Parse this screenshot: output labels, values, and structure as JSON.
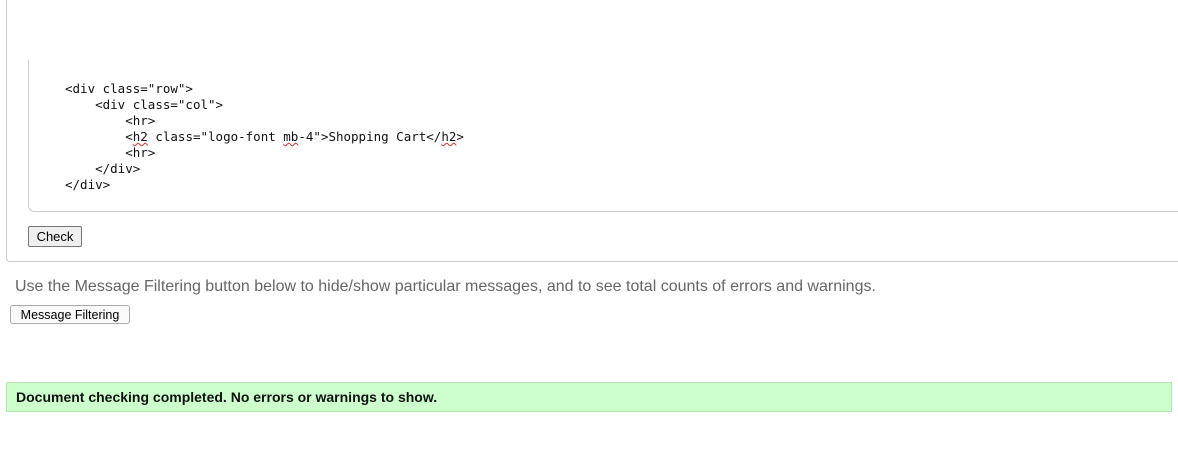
{
  "source": {
    "lines": [
      {
        "indent": 0,
        "segments": [
          {
            "text": "<div class=\"row\">",
            "spell": false
          }
        ]
      },
      {
        "indent": 1,
        "segments": [
          {
            "text": "<div class=\"col\">",
            "spell": false
          }
        ]
      },
      {
        "indent": 2,
        "segments": [
          {
            "text": "<hr>",
            "spell": false
          }
        ]
      },
      {
        "indent": 2,
        "segments": [
          {
            "text": "<",
            "spell": false
          },
          {
            "text": "h2",
            "spell": true
          },
          {
            "text": " class=\"logo-font ",
            "spell": false
          },
          {
            "text": "mb",
            "spell": true
          },
          {
            "text": "-4\">Shopping Cart</",
            "spell": false
          },
          {
            "text": "h2",
            "spell": true
          },
          {
            "text": ">",
            "spell": false
          }
        ]
      },
      {
        "indent": 2,
        "segments": [
          {
            "text": "<hr>",
            "spell": false
          }
        ]
      },
      {
        "indent": 1,
        "segments": [
          {
            "text": "</div>",
            "spell": false
          }
        ]
      },
      {
        "indent": 0,
        "segments": [
          {
            "text": "</div>",
            "spell": false
          }
        ]
      }
    ]
  },
  "check_button": {
    "label": "Check"
  },
  "info": {
    "text": "Use the Message Filtering button below to hide/show particular messages, and to see total counts of errors and warnings."
  },
  "filter_button": {
    "label": "Message Filtering"
  },
  "status": {
    "text": "Document checking completed. No errors or warnings to show.",
    "background": "#ccffcc"
  }
}
